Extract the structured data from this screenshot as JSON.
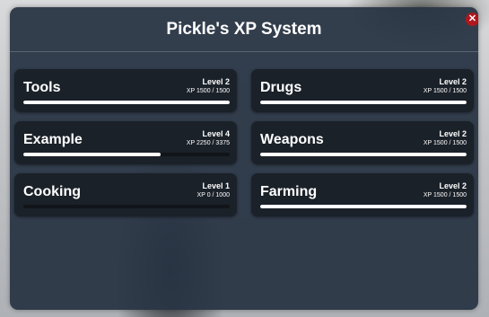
{
  "window": {
    "title": "Pickle's XP System",
    "close_icon": "close-icon",
    "close_glyph": "✕"
  },
  "colors": {
    "panel": "#283444",
    "card": "#1b2129",
    "bar_fill": "#ffffff",
    "close": "#b0161c"
  },
  "skills": [
    {
      "name": "Tools",
      "level": "Level 2",
      "xp": "XP 1500 / 1500",
      "progress": 1.0
    },
    {
      "name": "Drugs",
      "level": "Level 2",
      "xp": "XP 1500 / 1500",
      "progress": 1.0
    },
    {
      "name": "Example",
      "level": "Level 4",
      "xp": "XP 2250 / 3375",
      "progress": 0.667
    },
    {
      "name": "Weapons",
      "level": "Level 2",
      "xp": "XP 1500 / 1500",
      "progress": 1.0
    },
    {
      "name": "Cooking",
      "level": "Level 1",
      "xp": "XP 0 / 1000",
      "progress": 0.0
    },
    {
      "name": "Farming",
      "level": "Level 2",
      "xp": "XP 1500 / 1500",
      "progress": 1.0
    }
  ]
}
